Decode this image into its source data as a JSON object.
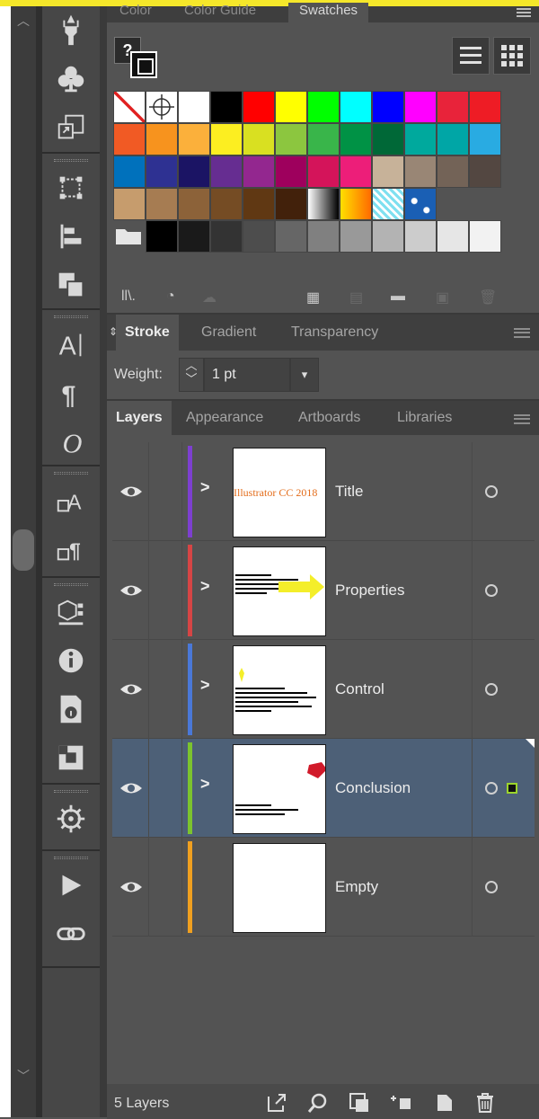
{
  "swatches_panel": {
    "tabs": [
      "Color",
      "Color Guide",
      "Swatches"
    ],
    "active_tab": "Swatches",
    "help_label": "?",
    "rows": [
      [
        "none",
        "registration",
        "#ffffff",
        "#000000",
        "#ff0000",
        "#ffff00",
        "#00ff00",
        "#00ffff",
        "#0000ff",
        "#ff00ff",
        "#e8233a",
        "#ee1c25"
      ],
      [
        "#f15a24",
        "#f7931e",
        "#fbb03b",
        "#fcee21",
        "#d9e021",
        "#8cc63f",
        "#39b54a",
        "#009245",
        "#006837",
        "#00a99d",
        "#00a6a6",
        "#29abe2"
      ],
      [
        "#0071bc",
        "#2e3192",
        "#1b1464",
        "#662d91",
        "#93278f",
        "#9e005d",
        "#d4145a",
        "#ed1e79",
        "#c7b299",
        "#998675",
        "#736357",
        "#534741"
      ],
      [
        "#c69c6d",
        "#a67c52",
        "#8c6239",
        "#754c24",
        "#603813",
        "#42210b",
        "gradient-bw",
        "gradient-orange",
        "pattern-cyan",
        "pattern-blue"
      ],
      [
        "folder",
        "#000000",
        "#1a1a1a",
        "#333333",
        "#4d4d4d",
        "#666666",
        "#808080",
        "#999999",
        "#b3b3b3",
        "#cccccc",
        "#e6e6e6",
        "#f2f2f2"
      ]
    ]
  },
  "stroke_panel": {
    "tabs": [
      "Stroke",
      "Gradient",
      "Transparency"
    ],
    "active_tab": "Stroke",
    "weight_label": "Weight:",
    "weight_value": "1 pt"
  },
  "layers_panel": {
    "tabs": [
      "Layers",
      "Appearance",
      "Artboards",
      "Libraries"
    ],
    "active_tab": "Layers",
    "layers": [
      {
        "name": "Title",
        "color": "#7d3fd0",
        "selected": false,
        "thumb_text": "Illustrator CC 2018"
      },
      {
        "name": "Properties",
        "color": "#d64545",
        "selected": false,
        "thumb_text": ""
      },
      {
        "name": "Control",
        "color": "#4a78d8",
        "selected": false,
        "thumb_text": ""
      },
      {
        "name": "Conclusion",
        "color": "#7cc32e",
        "selected": true,
        "thumb_text": ""
      },
      {
        "name": "Empty",
        "color": "#f0a020",
        "selected": false,
        "thumb_text": ""
      }
    ],
    "count_label": "5 Layers"
  },
  "tools": [
    "puppet-warp-icon",
    "symbol-club-icon",
    "artboard-export-icon",
    "transform-icon",
    "align-icon",
    "pathfinder-icon",
    "character-icon",
    "paragraph-icon",
    "opentype-icon",
    "character-styles-icon",
    "paragraph-styles-icon",
    "3d-materials-icon",
    "info-icon",
    "document-info-icon",
    "links-export-icon",
    "navigator-icon",
    "actions-play-icon",
    "links-icon"
  ]
}
